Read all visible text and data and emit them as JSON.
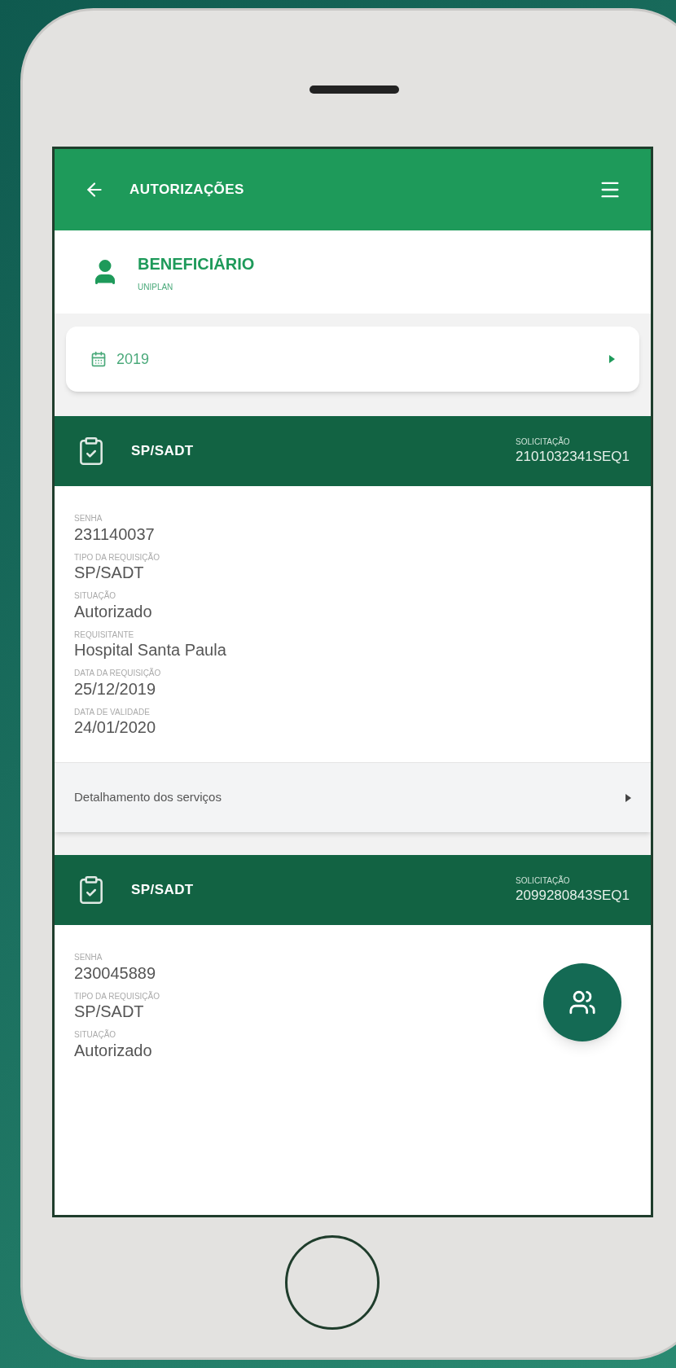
{
  "app_bar": {
    "title": "AUTORIZAÇÕES"
  },
  "beneficiary": {
    "label": "BENEFICIÁRIO",
    "plan": "UNIPLAN"
  },
  "year_filter": {
    "value": "2019"
  },
  "authorizations": [
    {
      "type": "SP/SADT",
      "request_label": "SOLICITAÇÃO",
      "request_number": "2101032341SEQ1",
      "fields": [
        {
          "label": "SENHA",
          "value": "231140037"
        },
        {
          "label": "TIPO DA REQUISIÇÃO",
          "value": "SP/SADT"
        },
        {
          "label": "SITUAÇÃO",
          "value": "Autorizado"
        },
        {
          "label": "REQUISITANTE",
          "value": "Hospital Santa Paula"
        },
        {
          "label": "DATA DA REQUISIÇÃO",
          "value": "25/12/2019"
        },
        {
          "label": "DATA DE VALIDADE",
          "value": "24/01/2020"
        }
      ],
      "details_link": "Detalhamento dos serviços"
    },
    {
      "type": "SP/SADT",
      "request_label": "SOLICITAÇÃO",
      "request_number": "2099280843SEQ1",
      "fields": [
        {
          "label": "SENHA",
          "value": "230045889"
        },
        {
          "label": "TIPO DA REQUISIÇÃO",
          "value": "SP/SADT"
        },
        {
          "label": "SITUAÇÃO",
          "value": "Autorizado"
        }
      ]
    }
  ]
}
